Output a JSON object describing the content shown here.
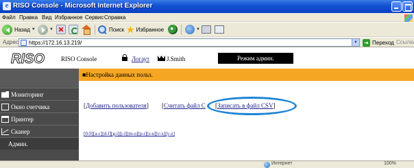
{
  "window": {
    "title": "RISO Console - Microsoft Internet Explorer"
  },
  "menu": [
    "Файл",
    "Правка",
    "Вид",
    "Избранное",
    "Сервис",
    "Справка"
  ],
  "toolbar": {
    "back_label": "Назад",
    "search_label": "Поиск",
    "favorites_label": "Избранное"
  },
  "address": {
    "label": "Адрес:",
    "url": "https://172.16.13.219/",
    "go_label": "Переход",
    "links_label": "Ссылки"
  },
  "header": {
    "logo_text": "RISO",
    "brand": "RISO Console",
    "logout_label": "Логаут",
    "user": "J.Smith",
    "admin_mode": "Режим админ."
  },
  "sidebar": {
    "items": [
      {
        "label": "Мониторинг",
        "icon": "monitor-icon"
      },
      {
        "label": "Окно счетчика",
        "icon": "counter-icon"
      },
      {
        "label": "Принтер",
        "icon": "printer-icon"
      },
      {
        "label": "Сканер",
        "icon": "scanner-icon"
      },
      {
        "label": "Админ."
      }
    ]
  },
  "main": {
    "section_title": "■Настройка данных польз.",
    "links": {
      "add_user": "Добавить пользователя",
      "read_file": "Считать файл С",
      "write_csv": "Записать в файл CSV"
    },
    "alpha_index": "[0-9][a-c][d-f][g-i][j-l][m-o][p-r][s-u][v-x][y-z]"
  },
  "status": {
    "zone": "Интернет",
    "zoom": "100%"
  },
  "colors": {
    "title_bar": "#1454d4",
    "sidebar": "#4a4a4a",
    "section_bar": "#f5a623",
    "highlight_ring": "#1e84d4"
  }
}
